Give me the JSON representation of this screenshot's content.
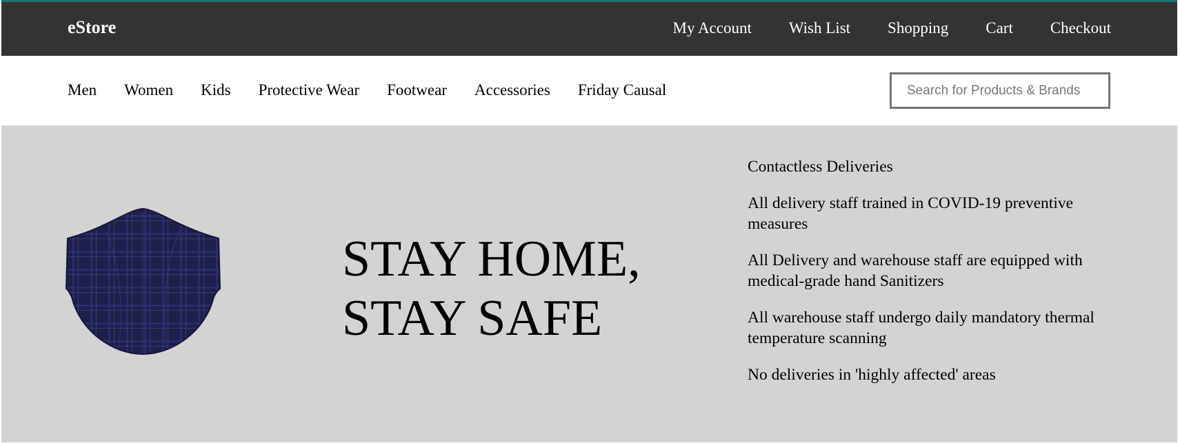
{
  "header": {
    "brand": "eStore",
    "links": [
      "My Account",
      "Wish List",
      "Shopping",
      "Cart",
      "Checkout"
    ]
  },
  "nav": {
    "categories": [
      "Men",
      "Women",
      "Kids",
      "Protective Wear",
      "Footwear",
      "Accessories",
      "Friday Causal"
    ],
    "search_placeholder": "Search for Products & Brands"
  },
  "hero": {
    "image_icon": "face-mask-icon",
    "headline_line1": "STAY HOME,",
    "headline_line2": "STAY SAFE",
    "notes": [
      "Contactless Deliveries",
      "All delivery staff trained in COVID-19 preventive measures",
      "All Delivery and warehouse staff are equipped with medical-grade hand Sanitizers",
      "All warehouse staff undergo daily mandatory thermal temperature scanning",
      "No deliveries in 'highly affected' areas"
    ]
  },
  "colors": {
    "topbar_bg": "#333333",
    "topbar_accent": "#1f6f6f",
    "hero_bg": "#d3d3d3",
    "mask_fabric": "#1e1f4a"
  }
}
